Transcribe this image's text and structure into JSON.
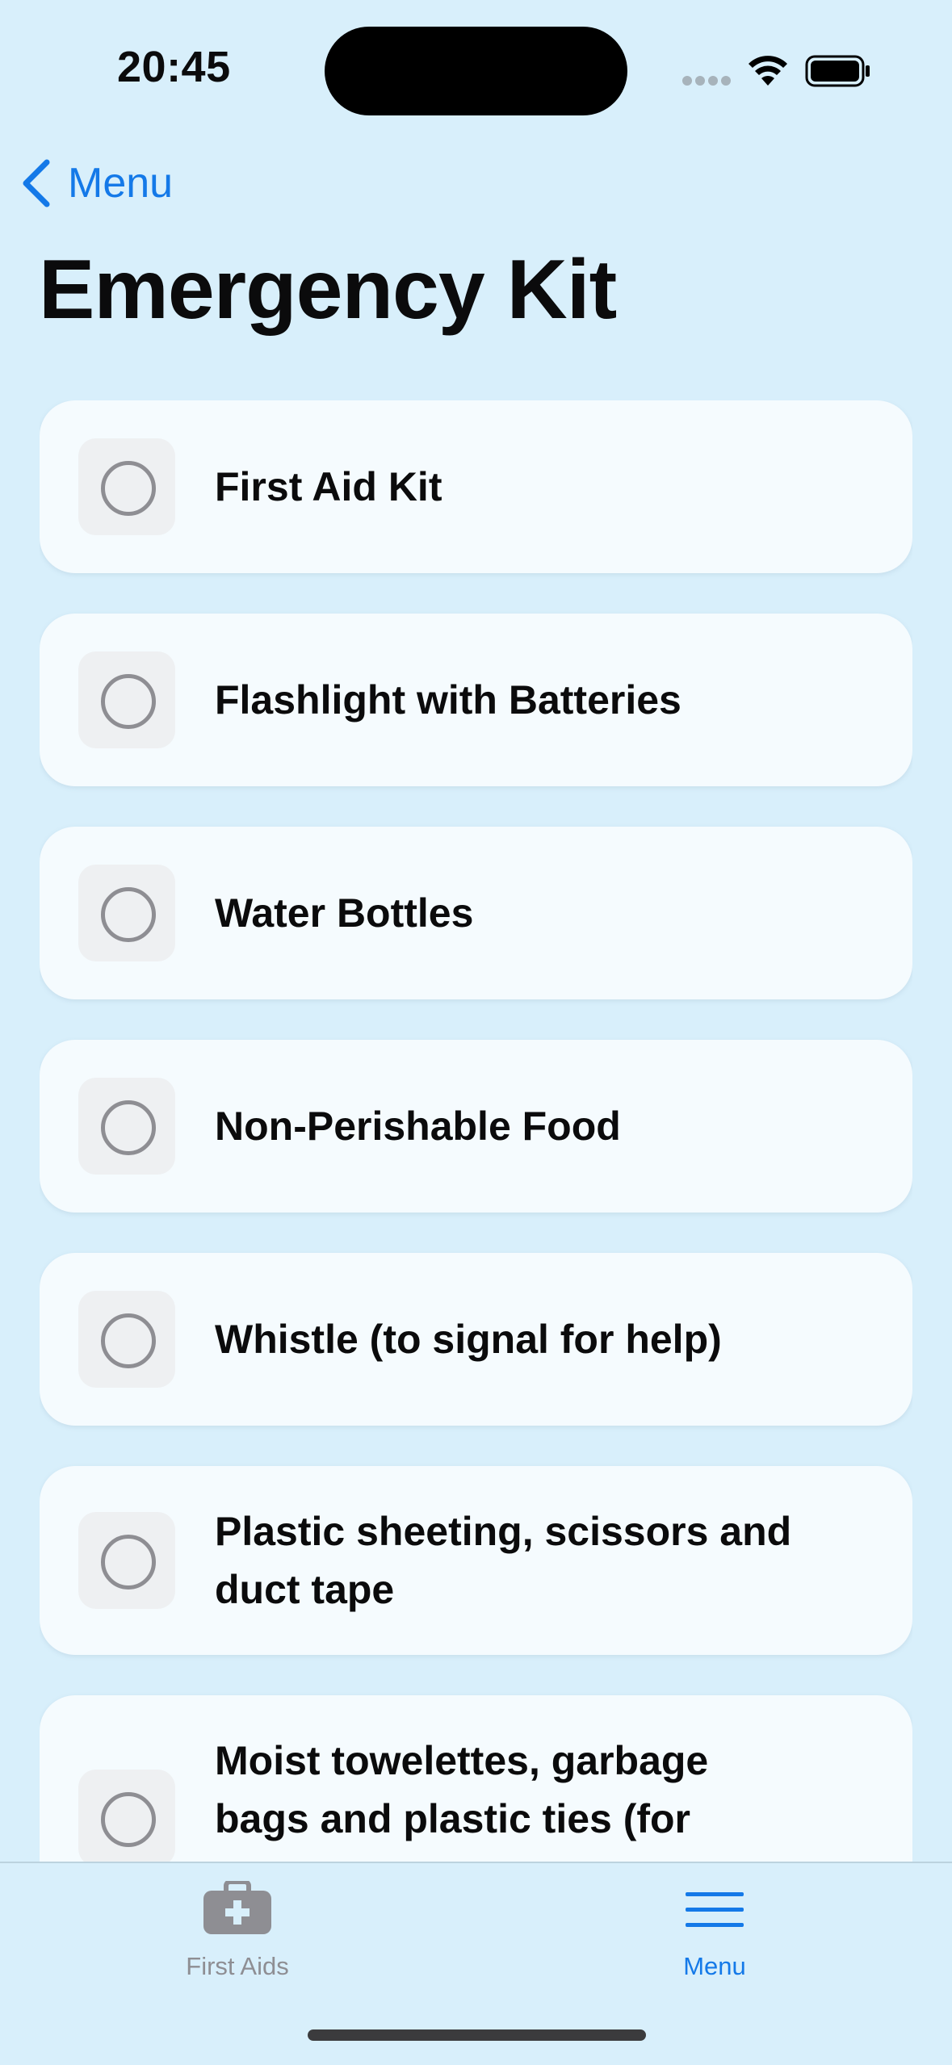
{
  "status_bar": {
    "time": "20:45"
  },
  "nav": {
    "back_label": "Menu",
    "title": "Emergency Kit"
  },
  "items": [
    {
      "label": "First Aid Kit",
      "checked": false
    },
    {
      "label": "Flashlight with Batteries",
      "checked": false
    },
    {
      "label": "Water Bottles",
      "checked": false
    },
    {
      "label": "Non-Perishable Food",
      "checked": false
    },
    {
      "label": "Whistle (to signal for help)",
      "checked": false
    },
    {
      "label": "Plastic sheeting, scissors and duct tape",
      "checked": false
    },
    {
      "label": "Moist towelettes, garbage bags and plastic ties (for",
      "checked": false
    }
  ],
  "tab_bar": {
    "tabs": [
      {
        "label": "First Aids",
        "icon": "first-aid-kit-icon",
        "selected": false
      },
      {
        "label": "Menu",
        "icon": "hamburger-menu-icon",
        "selected": true
      }
    ]
  },
  "colors": {
    "background": "#d8effb",
    "card": "#f5fbfe",
    "accent": "#1479e8",
    "inactive_tab": "#8e8e93"
  }
}
